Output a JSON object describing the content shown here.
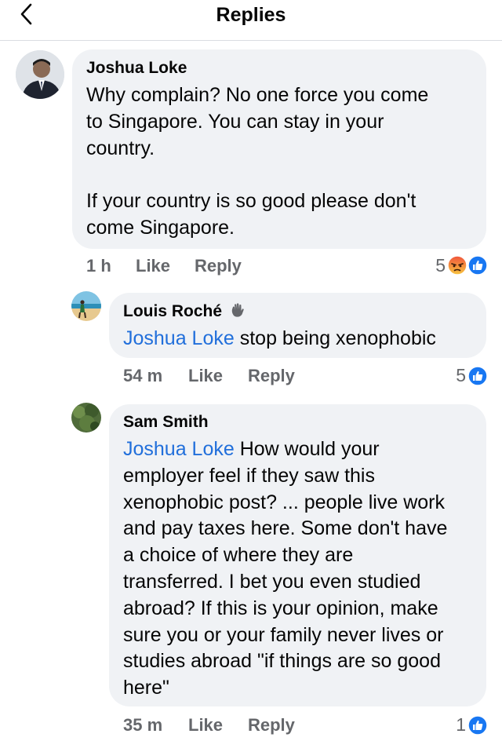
{
  "header": {
    "title": "Replies",
    "back_icon": "chevron-left-icon"
  },
  "colors": {
    "mention": "#216fdb",
    "meta": "#65676b",
    "bubble": "#f0f2f5",
    "like": "#1877f2",
    "angry": "#f0533c"
  },
  "actions": {
    "like": "Like",
    "reply": "Reply"
  },
  "comments": [
    {
      "author": "Joshua Loke",
      "text": "Why complain? No one force you come\nto Singapore. You can stay in your\ncountry.\n\nIf your country is so good please don't\ncome Singapore.",
      "time": "1 h",
      "reaction_count": "5",
      "reactions": [
        "angry-reaction-icon",
        "like-reaction-icon"
      ]
    },
    {
      "author": "Louis Roché",
      "badge_icon": "waving-hand-icon",
      "mention": "Joshua Loke",
      "text": " stop being xenophobic",
      "time": "54 m",
      "reaction_count": "5",
      "reactions": [
        "like-reaction-icon"
      ]
    },
    {
      "author": "Sam Smith",
      "mention": "Joshua Loke",
      "text": " How would your\nemployer feel if they saw this\nxenophobic post? ... people live work\nand pay taxes here. Some don't have\na choice of where they are\ntransferred. I bet you even studied\nabroad? If this is your opinion, make\nsure you or your family never lives or\nstudies abroad \"if things are so good\nhere\"",
      "time": "35 m",
      "reaction_count": "1",
      "reactions": [
        "like-reaction-icon"
      ]
    }
  ]
}
